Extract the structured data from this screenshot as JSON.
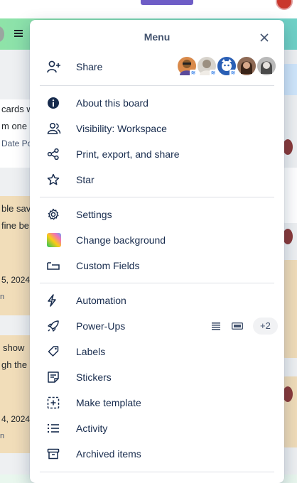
{
  "menu": {
    "title": "Menu",
    "share": {
      "label": "Share"
    },
    "members": [
      {
        "name": "member-1",
        "color": "#d98a4b",
        "face": "#8a5a2b",
        "badge": true
      },
      {
        "name": "member-2",
        "color": "#d8d4cd",
        "face": "#9b8f80",
        "badge": true
      },
      {
        "name": "member-3",
        "color": "#2a5fb5",
        "face": "#ffffff",
        "badge": true
      },
      {
        "name": "member-4",
        "color": "#8e6a55",
        "face": "#3a2418",
        "badge": false
      },
      {
        "name": "member-5",
        "color": "#b9b9b9",
        "face": "#4a4a4a",
        "badge": false
      }
    ],
    "section1": {
      "about": "About this board",
      "visibility": "Visibility: Workspace",
      "print": "Print, export, and share",
      "star": "Star"
    },
    "section2": {
      "settings": "Settings",
      "background": "Change background",
      "custom_fields": "Custom Fields"
    },
    "section3": {
      "automation": "Automation",
      "powerups": "Power-Ups",
      "powerups_more": "+2",
      "labels": "Labels",
      "stickers": "Stickers",
      "template": "Make template",
      "activity": "Activity",
      "archived": "Archived items"
    }
  },
  "background_board": {
    "card1": [
      "cards w",
      "m one b"
    ],
    "card1_meta": "Date Po",
    "card2": [
      "ble sav",
      "fine be"
    ],
    "card2_date": "5, 2024",
    "card2_extra": "n",
    "card3": [
      "show",
      "gh the"
    ],
    "card3_date": "4, 2024",
    "card3_extra": "n"
  }
}
